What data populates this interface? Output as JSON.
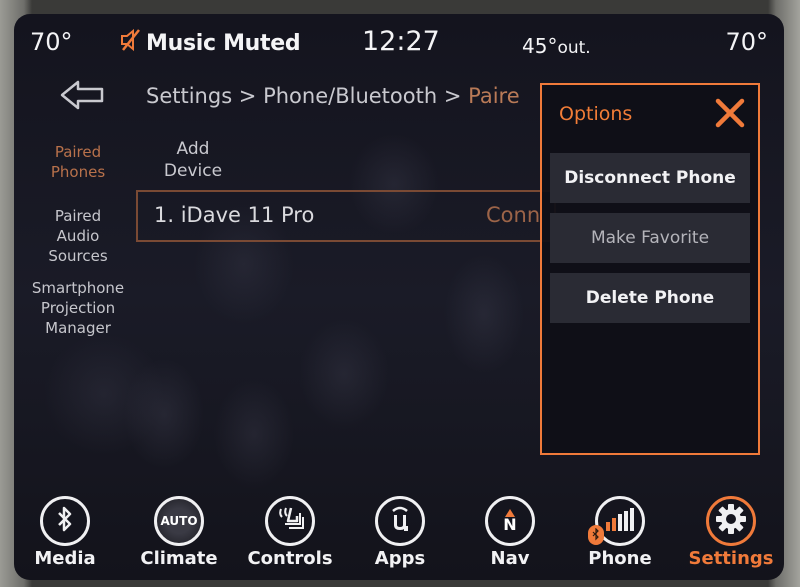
{
  "status_bar": {
    "driver_temp": "70°",
    "passenger_temp": "70°",
    "audio_status": "Music Muted",
    "audio_icon": "speaker-muted-icon",
    "clock": "12:27",
    "outside_temp": "45°",
    "outside_unit": "out."
  },
  "header": {
    "back_icon": "back-arrow-icon",
    "breadcrumb": {
      "parts": [
        "Settings",
        "Phone/Bluetooth"
      ],
      "separator": " > ",
      "current": "Paired Phones"
    },
    "breadcrumb_prefix": "Settings > Phone/Bluetooth > ",
    "breadcrumb_current": "Paire"
  },
  "sidebar": {
    "items": [
      {
        "label_line1": "Paired",
        "label_line2": "Phones",
        "active": true
      },
      {
        "label_line1": "Paired",
        "label_line2": "Audio",
        "label_line3": "Sources",
        "active": false
      },
      {
        "label_line1": "Smartphone",
        "label_line2": "Projection",
        "label_line3": "Manager",
        "active": false
      }
    ]
  },
  "main": {
    "add_device_line1": "Add",
    "add_device_line2": "Device",
    "devices": [
      {
        "name": "1. iDave 11 Pro",
        "status": "Conn"
      }
    ]
  },
  "options_popup": {
    "title": "Options",
    "close_icon": "close-x-icon",
    "buttons": [
      {
        "label": "Disconnect Phone",
        "enabled": true
      },
      {
        "label": "Make Favorite",
        "enabled": false
      },
      {
        "label": "Delete Phone",
        "enabled": true
      }
    ]
  },
  "bottom_nav": {
    "items": [
      {
        "label": "Media",
        "icon": "bluetooth-icon",
        "active": false
      },
      {
        "label": "Climate",
        "icon": "climate-auto-icon",
        "icon_text": "AUTO",
        "active": false
      },
      {
        "label": "Controls",
        "icon": "seat-controls-icon",
        "active": false
      },
      {
        "label": "Apps",
        "icon": "uconnect-apps-icon",
        "active": false
      },
      {
        "label": "Nav",
        "icon": "compass-north-icon",
        "icon_text": "N",
        "active": false
      },
      {
        "label": "Phone",
        "icon": "signal-bars-icon",
        "active": false
      },
      {
        "label": "Settings",
        "icon": "gear-icon",
        "active": true
      }
    ]
  },
  "colors": {
    "accent": "#f07a3a",
    "active_text": "#b8714b",
    "text": "#e6e6ea",
    "background": "#16161f",
    "button_bg": "#2a2b34"
  }
}
